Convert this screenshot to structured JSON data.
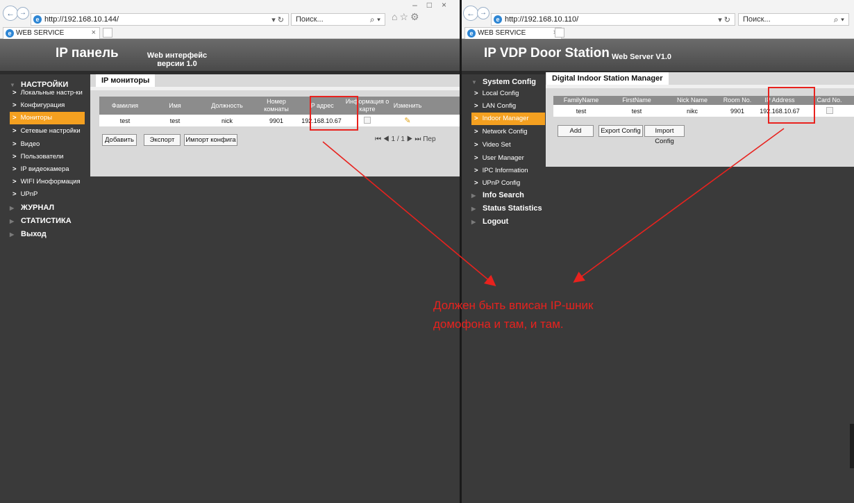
{
  "left": {
    "url": "http://192.168.10.144/",
    "search_placeholder": "Поиск...",
    "tab_label": "WEB SERVICE",
    "app_title": "IP панель",
    "app_sub_line1": "Web интерфейс",
    "app_sub_line2": "версии 1.0",
    "menu": {
      "settings": "НАСТРОЙКИ",
      "sub": [
        "Локальные настр-ки",
        "Конфигурация",
        "Мониторы",
        "Сетевые настройки",
        "Видео",
        "Пользователи",
        "IP видеокамера",
        "WIFI Иноформация",
        "UPnP"
      ],
      "journal": "ЖУРНАЛ",
      "stats": "СТАТИСТИКА",
      "exit": "Выход"
    },
    "content_tab": "IP мониторы",
    "table": {
      "headers": [
        "Фамилия",
        "Имя",
        "Должность",
        "Номер комнаты",
        "IP адрес",
        "Информация о карте",
        "Изменить"
      ],
      "row": [
        "test",
        "test",
        "nick",
        "9901",
        "192.168.10.67"
      ]
    },
    "buttons": {
      "add": "Добавить",
      "export": "Экспорт",
      "import": "Импорт конфига"
    },
    "pager": "⏮ ◀ 1 / 1 ▶ ⏭ Пер"
  },
  "right": {
    "url": "http://192.168.10.110/",
    "search_placeholder": "Поиск...",
    "tab_label": "WEB SERVICE",
    "app_title": "IP VDP Door Station",
    "app_sub": "Web Server V1.0",
    "menu": {
      "system_config": "System Config",
      "sub": [
        "Local Config",
        "LAN Config",
        "Indoor Manager",
        "Network Config",
        "Video Set",
        "User Manager",
        "IPC Information",
        "UPnP Config"
      ],
      "info_search": "Info Search",
      "status_statistics": "Status Statistics",
      "logout": "Logout"
    },
    "content_tab": "Digital Indoor Station Manager",
    "table": {
      "headers": [
        "FamilyName",
        "FirstName",
        "Nick Name",
        "Room No.",
        "IP Address",
        "Card No."
      ],
      "row": [
        "test",
        "test",
        "nikc",
        "9901",
        "192.168.10.67"
      ]
    },
    "buttons": {
      "add": "Add",
      "export": "Export Config",
      "import": "Import Config"
    }
  },
  "annotation": {
    "line1": "Должен быть вписан IP-шник",
    "line2": "домофона и там, и там."
  },
  "colors": {
    "accent": "#f4a020",
    "annotation": "#e8221e",
    "header": "#5a5a5a",
    "panel": "#d9d9d9"
  }
}
